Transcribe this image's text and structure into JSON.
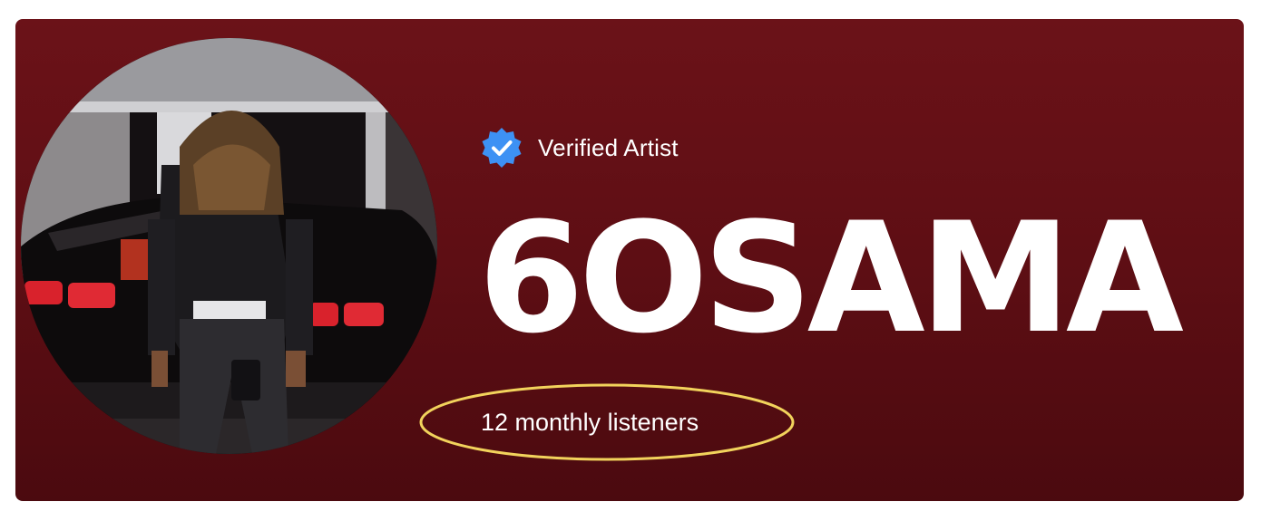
{
  "artist": {
    "verified_label": "Verified Artist",
    "name": "6OSAMA",
    "monthly_listeners": "12 monthly listeners"
  },
  "colors": {
    "banner_top": "#6b1218",
    "banner_bottom": "#4b0a0f",
    "verified_blue": "#3d91f4",
    "highlight_ellipse": "#f2d35c",
    "text": "#ffffff"
  },
  "icons": {
    "verified": "verified-badge-icon"
  },
  "images": {
    "avatar": "artist-profile-photo"
  }
}
